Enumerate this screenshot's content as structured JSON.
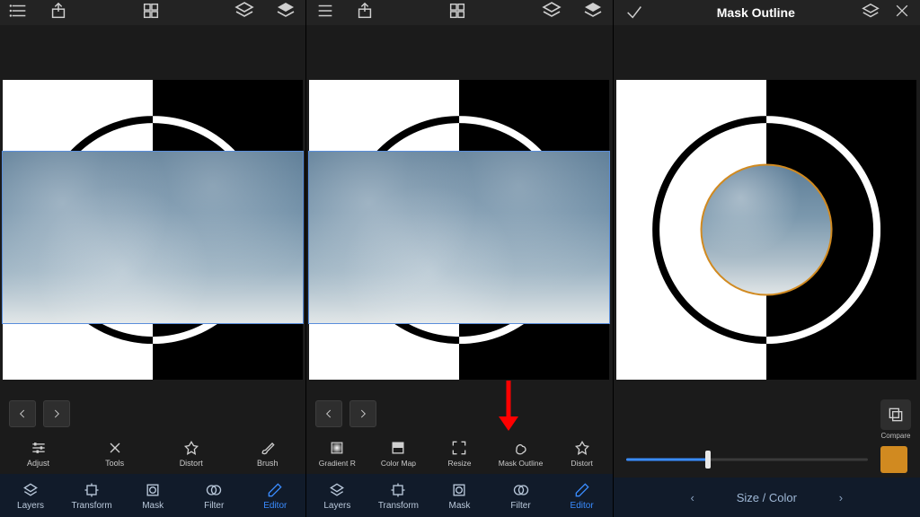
{
  "panel1": {
    "nav": {
      "prev": "‹",
      "next": "›"
    },
    "tools": [
      {
        "label": "Adjust"
      },
      {
        "label": "Tools"
      },
      {
        "label": "Distort"
      },
      {
        "label": "Brush"
      }
    ],
    "tabs": [
      {
        "label": "Layers"
      },
      {
        "label": "Transform"
      },
      {
        "label": "Mask"
      },
      {
        "label": "Filter"
      },
      {
        "label": "Editor",
        "active": true
      }
    ]
  },
  "panel2": {
    "nav": {
      "prev": "‹",
      "next": "›"
    },
    "tools": [
      {
        "label": "Gradient R"
      },
      {
        "label": "Color Map"
      },
      {
        "label": "Resize"
      },
      {
        "label": "Mask Outline"
      },
      {
        "label": "Distort"
      }
    ],
    "tabs": [
      {
        "label": "Layers"
      },
      {
        "label": "Transform"
      },
      {
        "label": "Mask"
      },
      {
        "label": "Filter"
      },
      {
        "label": "Editor",
        "active": true
      }
    ]
  },
  "panel3": {
    "title": "Mask Outline",
    "compare": "Compare",
    "slider": {
      "percent": 34
    },
    "swatch_color": "#d18a20",
    "modebar": {
      "label": "Size / Color"
    }
  }
}
